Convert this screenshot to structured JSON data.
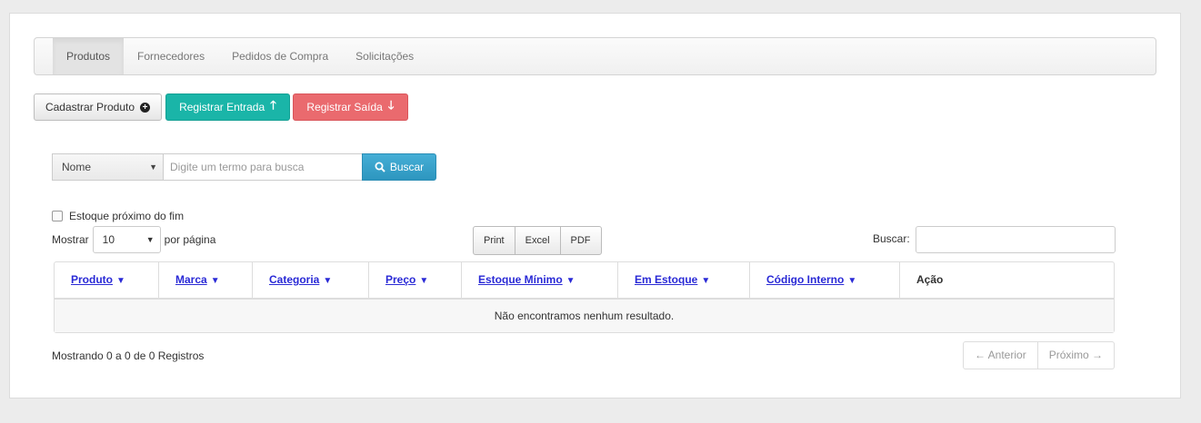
{
  "tabs": [
    {
      "label": "Produtos",
      "active": true
    },
    {
      "label": "Fornecedores",
      "active": false
    },
    {
      "label": "Pedidos de Compra",
      "active": false
    },
    {
      "label": "Solicitações",
      "active": false
    }
  ],
  "actions": {
    "register_product": "Cadastrar Produto",
    "register_entry": "Registrar Entrada",
    "register_exit": "Registrar Saída"
  },
  "search": {
    "field_selected": "Nome",
    "placeholder": "Digite um termo para busca",
    "button_label": "Buscar"
  },
  "filters": {
    "low_stock_label": "Estoque próximo do fim",
    "low_stock_checked": false,
    "show_label": "Mostrar",
    "page_length": "10",
    "per_page_label": "por página",
    "filter_label": "Buscar:"
  },
  "export": [
    "Print",
    "Excel",
    "PDF"
  ],
  "table": {
    "columns": [
      "Produto",
      "Marca",
      "Categoria",
      "Preço",
      "Estoque Mínimo",
      "Em Estoque",
      "Código Interno",
      "Ação"
    ],
    "empty_message": "Não encontramos nenhum resultado."
  },
  "footer": {
    "info": "Mostrando 0 a 0 de 0 Registros",
    "prev": "← Anterior",
    "next": "Próximo →"
  },
  "colors": {
    "green": "#1ab5a8",
    "red": "#ea6a6e",
    "blue": "#2d96bf",
    "link": "#2a2ad6"
  }
}
